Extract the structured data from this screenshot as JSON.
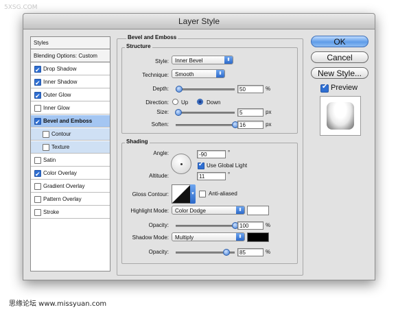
{
  "watermark": "5XSG.COM",
  "dialog": {
    "title": "Layer Style"
  },
  "styles_list": {
    "header": "Styles",
    "blending": "Blending Options: Custom",
    "items": [
      {
        "label": "Drop Shadow",
        "checked": true
      },
      {
        "label": "Inner Shadow",
        "checked": true
      },
      {
        "label": "Outer Glow",
        "checked": true
      },
      {
        "label": "Inner Glow",
        "checked": false
      },
      {
        "label": "Bevel and Emboss",
        "checked": true,
        "selected": true
      },
      {
        "label": "Contour",
        "checked": false,
        "sub": true
      },
      {
        "label": "Texture",
        "checked": false,
        "sub": true
      },
      {
        "label": "Satin",
        "checked": false
      },
      {
        "label": "Color Overlay",
        "checked": true
      },
      {
        "label": "Gradient Overlay",
        "checked": false
      },
      {
        "label": "Pattern Overlay",
        "checked": false
      },
      {
        "label": "Stroke",
        "checked": false
      }
    ]
  },
  "bevel": {
    "section_title": "Bevel and Emboss",
    "structure": {
      "title": "Structure",
      "style_label": "Style:",
      "style_value": "Inner Bevel",
      "technique_label": "Technique:",
      "technique_value": "Smooth",
      "depth_label": "Depth:",
      "depth_value": "50",
      "depth_unit": "%",
      "depth_level": 0.05,
      "direction_label": "Direction:",
      "direction_up": "Up",
      "direction_down": "Down",
      "direction_selected": "Down",
      "size_label": "Size:",
      "size_value": "5",
      "size_unit": "px",
      "size_level": 0.03,
      "soften_label": "Soften:",
      "soften_value": "16",
      "soften_unit": "px",
      "soften_level": 1.0
    },
    "shading": {
      "title": "Shading",
      "angle_label": "Angle:",
      "angle_value": "-90",
      "angle_unit": "°",
      "global_light_label": "Use Global Light",
      "global_light_checked": true,
      "altitude_label": "Altitude:",
      "altitude_value": "11",
      "altitude_unit": "°",
      "gloss_label": "Gloss Contour:",
      "anti_aliased_label": "Anti-aliased",
      "anti_aliased_checked": false,
      "highlight_mode_label": "Highlight Mode:",
      "highlight_mode_value": "Color Dodge",
      "highlight_color": "#ffffff",
      "highlight_opacity_label": "Opacity:",
      "highlight_opacity_value": "100",
      "highlight_opacity_unit": "%",
      "highlight_opacity_level": 1.0,
      "shadow_mode_label": "Shadow Mode:",
      "shadow_mode_value": "Multiply",
      "shadow_color": "#000000",
      "shadow_opacity_label": "Opacity:",
      "shadow_opacity_value": "85",
      "shadow_opacity_unit": "%",
      "shadow_opacity_level": 0.85
    }
  },
  "buttons": {
    "ok": "OK",
    "cancel": "Cancel",
    "new_style": "New Style..."
  },
  "preview": {
    "label": "Preview",
    "checked": true
  },
  "footer": "思缘论坛  www.missyuan.com"
}
